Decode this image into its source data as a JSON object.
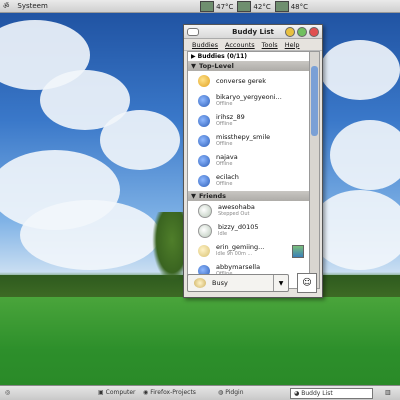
{
  "top_panel": {
    "menu_label": "Systeem",
    "temps": [
      {
        "value": "47°C"
      },
      {
        "value": "42°C"
      },
      {
        "value": "48°C"
      }
    ]
  },
  "window": {
    "title": "Buddy List",
    "menu": [
      "Buddies",
      "Accounts",
      "Tools",
      "Help"
    ],
    "buddies_label": "Buddies (0/11)",
    "groups": [
      {
        "name": "Top-Level",
        "buddies": [
          {
            "name": "converse gerek",
            "status": "",
            "icon": "aim"
          },
          {
            "name": "bikaryo_yergyeoni...",
            "status": "Offline",
            "icon": "msn"
          },
          {
            "name": "irihsz_89",
            "status": "Offline",
            "icon": "msn"
          },
          {
            "name": "missthepy_smile",
            "status": "Offline",
            "icon": "msn"
          },
          {
            "name": "najava",
            "status": "Offline",
            "icon": "msn"
          },
          {
            "name": "ecilach",
            "status": "Offline",
            "icon": "msn"
          }
        ]
      },
      {
        "name": "Friends",
        "buddies": [
          {
            "name": "awesohaba",
            "status": "Stepped Out",
            "icon": "away"
          },
          {
            "name": "bizzy_d0105",
            "status": "Idle",
            "icon": "away"
          },
          {
            "name": "erin_gemiing...",
            "status": "Idle 9h 00m ...",
            "icon": "idle",
            "badge": true
          },
          {
            "name": "abbymarsella",
            "status": "Offline",
            "icon": "msn"
          }
        ]
      }
    ],
    "status": "Busy"
  },
  "bottom_panel": {
    "tasks": [
      "Computer",
      "Firefox-Projects",
      "Pidgin",
      "Buddy List"
    ]
  },
  "colors": {
    "group_header": "#aeaca8",
    "scroll_thumb": "#7aa0d6"
  }
}
